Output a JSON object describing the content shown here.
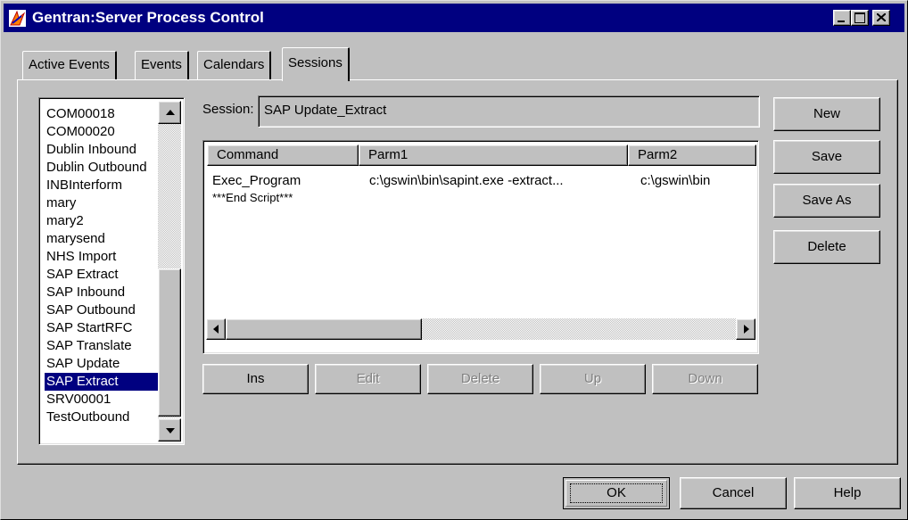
{
  "window": {
    "title": "Gentran:Server Process Control"
  },
  "tabs": [
    "Active Events",
    "Events",
    "Calendars",
    "Sessions"
  ],
  "active_tab": "Sessions",
  "session_list": {
    "items": [
      "COM00018",
      "COM00020",
      "Dublin Inbound",
      "Dublin Outbound",
      "INBInterform",
      "mary",
      "mary2",
      "marysend",
      "NHS Import",
      "SAP Extract",
      "SAP Inbound",
      "SAP Outbound",
      "SAP StartRFC",
      "SAP Translate",
      "SAP Update",
      "SAP Extract",
      "SRV00001",
      "TestOutbound"
    ],
    "selected_index": 15
  },
  "session": {
    "label": "Session:",
    "value": "SAP Update_Extract"
  },
  "command_grid": {
    "columns": [
      "Command",
      "Parm1",
      "Parm2"
    ],
    "rows": [
      [
        "Exec_Program",
        "c:\\gswin\\bin\\sapint.exe -extract...",
        "c:\\gswin\\bin"
      ],
      [
        "***End Script***",
        "",
        ""
      ]
    ]
  },
  "grid_buttons": {
    "ins": "Ins",
    "edit": "Edit",
    "delete": "Delete",
    "up": "Up",
    "down": "Down"
  },
  "side_buttons": {
    "new": "New",
    "save": "Save",
    "save_as": "Save As",
    "delete": "Delete"
  },
  "footer_buttons": {
    "ok": "OK",
    "cancel": "Cancel",
    "help": "Help"
  },
  "icons": {
    "app": "gentran-app-icon",
    "minimize": "minimize-icon",
    "maximize": "maximize-icon",
    "close": "close-icon"
  },
  "colors": {
    "title_bar": "#000080",
    "selection": "#000080",
    "face": "#c0c0c0"
  }
}
